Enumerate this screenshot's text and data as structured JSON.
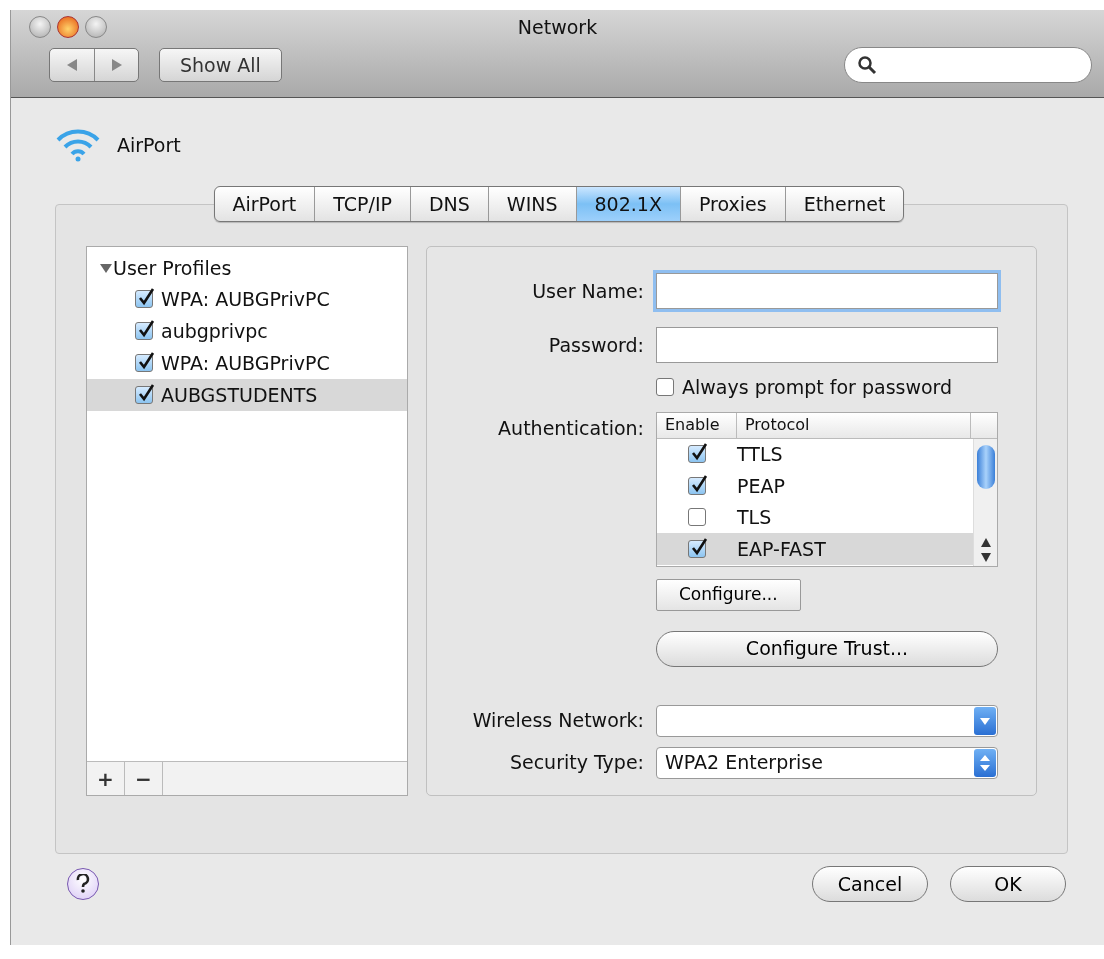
{
  "window": {
    "title": "Network"
  },
  "toolbar": {
    "show_all": "Show All"
  },
  "service": {
    "name": "AirPort"
  },
  "tabs": [
    {
      "label": "AirPort",
      "selected": false
    },
    {
      "label": "TCP/IP",
      "selected": false
    },
    {
      "label": "DNS",
      "selected": false
    },
    {
      "label": "WINS",
      "selected": false
    },
    {
      "label": "802.1X",
      "selected": true
    },
    {
      "label": "Proxies",
      "selected": false
    },
    {
      "label": "Ethernet",
      "selected": false
    }
  ],
  "profiles": {
    "label": "User Profiles",
    "expanded": true,
    "children": [
      {
        "label": "WPA: AUBGPrivPC",
        "checked": true,
        "selected": false
      },
      {
        "label": "aubgprivpc",
        "checked": true,
        "selected": false
      },
      {
        "label": "WPA: AUBGPrivPC",
        "checked": true,
        "selected": false
      },
      {
        "label": "AUBGSTUDENTS",
        "checked": true,
        "selected": true
      }
    ]
  },
  "list_buttons": [
    "+",
    "−"
  ],
  "form": {
    "user_name": {
      "label": "User Name:"
    },
    "password": {
      "label": "Password:"
    },
    "always_prompt": {
      "label": "Always prompt for password",
      "checked": false
    },
    "authentication": {
      "label": "Authentication:",
      "columns": [
        "Enable",
        "Protocol"
      ],
      "rows": [
        {
          "protocol": "TTLS",
          "checked": true,
          "selected": false
        },
        {
          "protocol": "PEAP",
          "checked": true,
          "selected": false
        },
        {
          "protocol": "TLS",
          "checked": false,
          "selected": false
        },
        {
          "protocol": "EAP-FAST",
          "checked": true,
          "selected": true
        }
      ]
    },
    "configure": "Configure...",
    "configure_trust": "Configure Trust...",
    "wireless_network": {
      "label": "Wireless Network:"
    },
    "security_type": {
      "label": "Security Type:",
      "value": "WPA2 Enterprise"
    }
  },
  "buttons": [
    "Cancel",
    "OK"
  ]
}
